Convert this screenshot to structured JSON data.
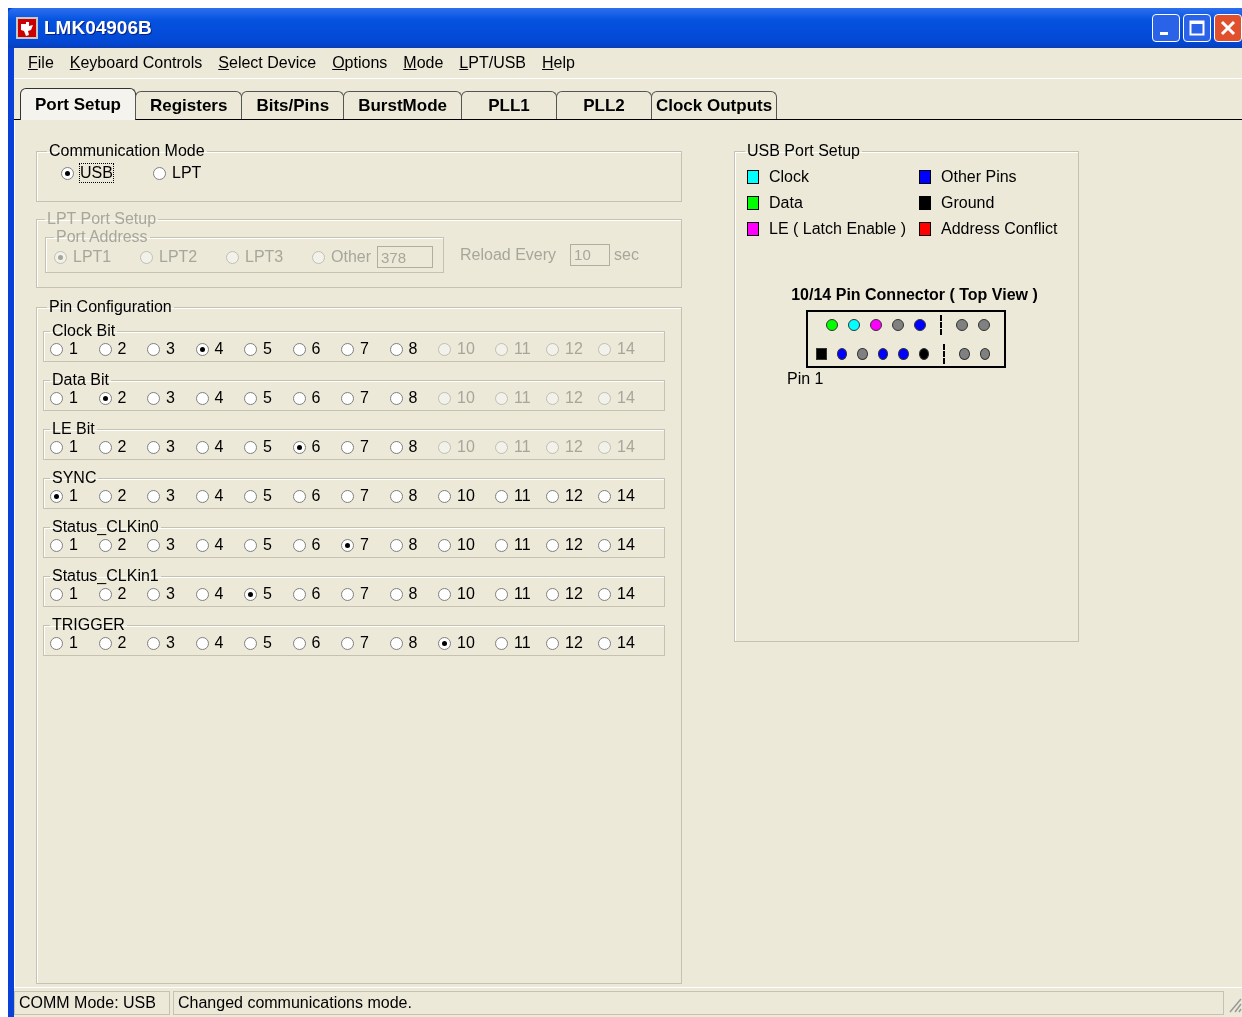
{
  "window": {
    "title": "LMK04906B"
  },
  "menu": [
    "File",
    "Keyboard Controls",
    "Select Device",
    "Options",
    "Mode",
    "LPT/USB",
    "Help"
  ],
  "tabs": [
    {
      "label": "Port Setup",
      "selected": true
    },
    {
      "label": "Registers",
      "selected": false
    },
    {
      "label": "Bits/Pins",
      "selected": false
    },
    {
      "label": "BurstMode",
      "selected": false
    },
    {
      "label": "PLL1",
      "selected": false
    },
    {
      "label": "PLL2",
      "selected": false
    },
    {
      "label": "Clock Outputs",
      "selected": false
    }
  ],
  "communication_mode": {
    "title": "Communication Mode",
    "options": [
      {
        "label": "USB",
        "selected": true,
        "focused": true
      },
      {
        "label": "LPT",
        "selected": false,
        "focused": false
      }
    ]
  },
  "lpt_port_setup": {
    "title": "LPT Port Setup",
    "disabled": true,
    "port_address": {
      "title": "Port Address",
      "options": [
        {
          "label": "LPT1",
          "selected": true
        },
        {
          "label": "LPT2",
          "selected": false
        },
        {
          "label": "LPT3",
          "selected": false
        },
        {
          "label": "Other",
          "selected": false
        }
      ],
      "other_value": "378"
    },
    "reload_label": "Reload Every",
    "reload_value": "10",
    "reload_unit": "sec"
  },
  "pin_configuration": {
    "title": "Pin Configuration",
    "groups": [
      {
        "label": "Clock Bit",
        "options": [
          {
            "label": "1",
            "selected": false,
            "disabled": false
          },
          {
            "label": "2",
            "selected": false,
            "disabled": false
          },
          {
            "label": "3",
            "selected": false,
            "disabled": false
          },
          {
            "label": "4",
            "selected": true,
            "disabled": false
          },
          {
            "label": "5",
            "selected": false,
            "disabled": false
          },
          {
            "label": "6",
            "selected": false,
            "disabled": false
          },
          {
            "label": "7",
            "selected": false,
            "disabled": false
          },
          {
            "label": "8",
            "selected": false,
            "disabled": false
          },
          {
            "label": "10",
            "selected": false,
            "disabled": true
          },
          {
            "label": "11",
            "selected": false,
            "disabled": true
          },
          {
            "label": "12",
            "selected": false,
            "disabled": true
          },
          {
            "label": "14",
            "selected": false,
            "disabled": true
          }
        ]
      },
      {
        "label": "Data Bit",
        "options": [
          {
            "label": "1",
            "selected": false,
            "disabled": false
          },
          {
            "label": "2",
            "selected": true,
            "disabled": false
          },
          {
            "label": "3",
            "selected": false,
            "disabled": false
          },
          {
            "label": "4",
            "selected": false,
            "disabled": false
          },
          {
            "label": "5",
            "selected": false,
            "disabled": false
          },
          {
            "label": "6",
            "selected": false,
            "disabled": false
          },
          {
            "label": "7",
            "selected": false,
            "disabled": false
          },
          {
            "label": "8",
            "selected": false,
            "disabled": false
          },
          {
            "label": "10",
            "selected": false,
            "disabled": true
          },
          {
            "label": "11",
            "selected": false,
            "disabled": true
          },
          {
            "label": "12",
            "selected": false,
            "disabled": true
          },
          {
            "label": "14",
            "selected": false,
            "disabled": true
          }
        ]
      },
      {
        "label": "LE Bit",
        "options": [
          {
            "label": "1",
            "selected": false,
            "disabled": false
          },
          {
            "label": "2",
            "selected": false,
            "disabled": false
          },
          {
            "label": "3",
            "selected": false,
            "disabled": false
          },
          {
            "label": "4",
            "selected": false,
            "disabled": false
          },
          {
            "label": "5",
            "selected": false,
            "disabled": false
          },
          {
            "label": "6",
            "selected": true,
            "disabled": false
          },
          {
            "label": "7",
            "selected": false,
            "disabled": false
          },
          {
            "label": "8",
            "selected": false,
            "disabled": false
          },
          {
            "label": "10",
            "selected": false,
            "disabled": true
          },
          {
            "label": "11",
            "selected": false,
            "disabled": true
          },
          {
            "label": "12",
            "selected": false,
            "disabled": true
          },
          {
            "label": "14",
            "selected": false,
            "disabled": true
          }
        ]
      },
      {
        "label": "SYNC",
        "options": [
          {
            "label": "1",
            "selected": true,
            "disabled": false
          },
          {
            "label": "2",
            "selected": false,
            "disabled": false
          },
          {
            "label": "3",
            "selected": false,
            "disabled": false
          },
          {
            "label": "4",
            "selected": false,
            "disabled": false
          },
          {
            "label": "5",
            "selected": false,
            "disabled": false
          },
          {
            "label": "6",
            "selected": false,
            "disabled": false
          },
          {
            "label": "7",
            "selected": false,
            "disabled": false
          },
          {
            "label": "8",
            "selected": false,
            "disabled": false
          },
          {
            "label": "10",
            "selected": false,
            "disabled": false
          },
          {
            "label": "11",
            "selected": false,
            "disabled": false
          },
          {
            "label": "12",
            "selected": false,
            "disabled": false
          },
          {
            "label": "14",
            "selected": false,
            "disabled": false
          }
        ]
      },
      {
        "label": "Status_CLKin0",
        "options": [
          {
            "label": "1",
            "selected": false,
            "disabled": false
          },
          {
            "label": "2",
            "selected": false,
            "disabled": false
          },
          {
            "label": "3",
            "selected": false,
            "disabled": false
          },
          {
            "label": "4",
            "selected": false,
            "disabled": false
          },
          {
            "label": "5",
            "selected": false,
            "disabled": false
          },
          {
            "label": "6",
            "selected": false,
            "disabled": false
          },
          {
            "label": "7",
            "selected": true,
            "disabled": false
          },
          {
            "label": "8",
            "selected": false,
            "disabled": false
          },
          {
            "label": "10",
            "selected": false,
            "disabled": false
          },
          {
            "label": "11",
            "selected": false,
            "disabled": false
          },
          {
            "label": "12",
            "selected": false,
            "disabled": false
          },
          {
            "label": "14",
            "selected": false,
            "disabled": false
          }
        ]
      },
      {
        "label": "Status_CLKin1",
        "options": [
          {
            "label": "1",
            "selected": false,
            "disabled": false
          },
          {
            "label": "2",
            "selected": false,
            "disabled": false
          },
          {
            "label": "3",
            "selected": false,
            "disabled": false
          },
          {
            "label": "4",
            "selected": false,
            "disabled": false
          },
          {
            "label": "5",
            "selected": true,
            "disabled": false
          },
          {
            "label": "6",
            "selected": false,
            "disabled": false
          },
          {
            "label": "7",
            "selected": false,
            "disabled": false
          },
          {
            "label": "8",
            "selected": false,
            "disabled": false
          },
          {
            "label": "10",
            "selected": false,
            "disabled": false
          },
          {
            "label": "11",
            "selected": false,
            "disabled": false
          },
          {
            "label": "12",
            "selected": false,
            "disabled": false
          },
          {
            "label": "14",
            "selected": false,
            "disabled": false
          }
        ]
      },
      {
        "label": "TRIGGER",
        "options": [
          {
            "label": "1",
            "selected": false,
            "disabled": false
          },
          {
            "label": "2",
            "selected": false,
            "disabled": false
          },
          {
            "label": "3",
            "selected": false,
            "disabled": false
          },
          {
            "label": "4",
            "selected": false,
            "disabled": false
          },
          {
            "label": "5",
            "selected": false,
            "disabled": false
          },
          {
            "label": "6",
            "selected": false,
            "disabled": false
          },
          {
            "label": "7",
            "selected": false,
            "disabled": false
          },
          {
            "label": "8",
            "selected": false,
            "disabled": false
          },
          {
            "label": "10",
            "selected": true,
            "disabled": false
          },
          {
            "label": "11",
            "selected": false,
            "disabled": false
          },
          {
            "label": "12",
            "selected": false,
            "disabled": false
          },
          {
            "label": "14",
            "selected": false,
            "disabled": false
          }
        ]
      }
    ]
  },
  "usb_port_setup": {
    "title": "USB Port Setup",
    "legend": [
      {
        "label": "Clock",
        "color": "#00ffff"
      },
      {
        "label": "Other Pins",
        "color": "#0000ff"
      },
      {
        "label": "Data",
        "color": "#00ff00"
      },
      {
        "label": "Ground",
        "color": "#000000"
      },
      {
        "label": "LE ( Latch Enable )",
        "color": "#ff00ff"
      },
      {
        "label": "Address Conflict",
        "color": "#ff0000"
      }
    ],
    "connector_title": "10/14 Pin Connector ( Top View )",
    "connector_rows": [
      {
        "pins": [
          {
            "kind": "circle",
            "color": "#00ff00"
          },
          {
            "kind": "circle",
            "color": "#00ffff"
          },
          {
            "kind": "circle",
            "color": "#ff00ff"
          },
          {
            "kind": "circle",
            "color": "#808080"
          },
          {
            "kind": "circle",
            "color": "#0000ff"
          },
          {
            "kind": "circle",
            "color": "#808080"
          },
          {
            "kind": "circle",
            "color": "#808080"
          }
        ]
      },
      {
        "pins": [
          {
            "kind": "square",
            "color": "#000000"
          },
          {
            "kind": "circle",
            "color": "#0000ff"
          },
          {
            "kind": "circle",
            "color": "#808080"
          },
          {
            "kind": "circle",
            "color": "#0000ff"
          },
          {
            "kind": "circle",
            "color": "#0000ff"
          },
          {
            "kind": "circle",
            "color": "#000000"
          },
          {
            "kind": "circle",
            "color": "#808080"
          },
          {
            "kind": "circle",
            "color": "#808080"
          }
        ]
      }
    ],
    "pin1_label": "Pin 1"
  },
  "status_bar": [
    "COMM Mode: USB",
    "Changed communications mode."
  ]
}
